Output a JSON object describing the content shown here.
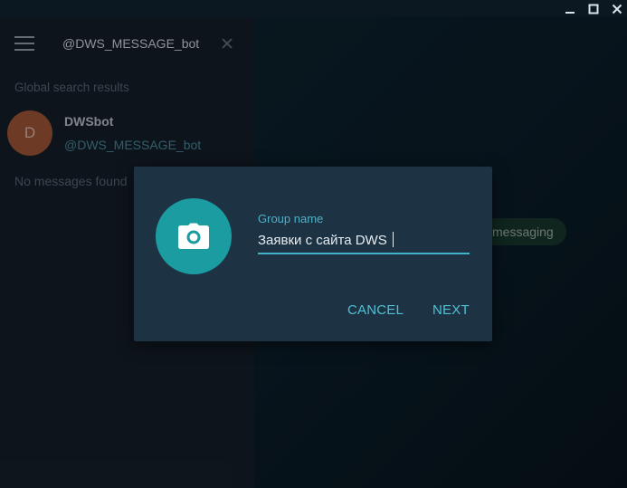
{
  "window": {
    "controls": [
      "minimize",
      "maximize",
      "close"
    ]
  },
  "sidebar": {
    "search": {
      "value": "@DWS_MESSAGE_bot"
    },
    "section_label": "Global search results",
    "result": {
      "avatar_letter": "D",
      "avatar_color": "#a85a3a",
      "name": "DWSbot",
      "username": "@DWS_MESSAGE_bot"
    },
    "empty_text": "No messages found"
  },
  "chat": {
    "service_badge": "messaging"
  },
  "dialog": {
    "field_label": "Group name",
    "group_name_value": "Заявки с сайта DWS",
    "cancel_label": "CANCEL",
    "next_label": "NEXT",
    "accent_color": "#4fc1d6",
    "photo_button_color": "#1a9ca0",
    "icon": "camera-icon"
  }
}
